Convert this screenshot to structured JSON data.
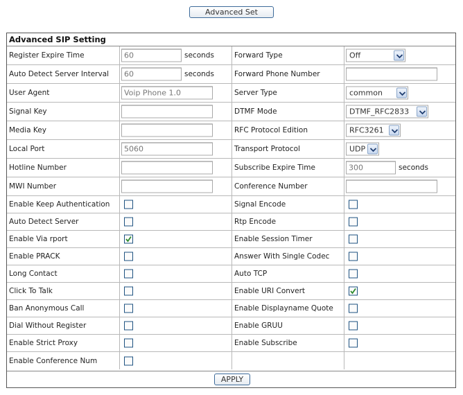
{
  "top": {
    "advanced_set_label": "Advanced Set"
  },
  "panel": {
    "title": "Advanced SIP Setting",
    "apply_label": "APPLY"
  },
  "units": {
    "seconds": "seconds"
  },
  "icons": {
    "dropdown": "chevron-down-icon",
    "checkbox_checked": "checkmark-icon"
  },
  "colors": {
    "checkmark": "#2e8b2e",
    "input_text": "#777777",
    "border": "#555555",
    "button_border": "#3c6a9a"
  },
  "text_rows": [
    {
      "left_label": "Register Expire Time",
      "left_value": "60",
      "left_unit": "seconds",
      "right_label": "Forward Type",
      "right_select": "Off"
    },
    {
      "left_label": "Auto Detect Server Interval",
      "left_value": "60",
      "left_unit": "seconds",
      "right_label": "Forward Phone Number",
      "right_value": ""
    },
    {
      "left_label": "User Agent",
      "left_value": "Voip Phone 1.0",
      "right_label": "Server Type",
      "right_select": "common"
    },
    {
      "left_label": "Signal Key",
      "left_value": "",
      "right_label": "DTMF Mode",
      "right_select": "DTMF_RFC2833"
    },
    {
      "left_label": "Media Key",
      "left_value": "",
      "right_label": "RFC Protocol Edition",
      "right_select": "RFC3261"
    },
    {
      "left_label": "Local Port",
      "left_value": "5060",
      "right_label": "Transport Protocol",
      "right_select": "UDP"
    },
    {
      "left_label": "Hotline Number",
      "left_value": "",
      "right_label": "Subscribe Expire Time",
      "right_value": "300",
      "right_unit": "seconds"
    },
    {
      "left_label": "MWI Number",
      "left_value": "",
      "right_label": "Conference Number",
      "right_value": ""
    }
  ],
  "check_rows": [
    {
      "left_label": "Enable Keep Authentication",
      "left_checked": false,
      "right_label": "Signal Encode",
      "right_checked": false
    },
    {
      "left_label": "Auto Detect Server",
      "left_checked": false,
      "right_label": "Rtp Encode",
      "right_checked": false
    },
    {
      "left_label": "Enable Via rport",
      "left_checked": true,
      "right_label": "Enable Session Timer",
      "right_checked": false
    },
    {
      "left_label": "Enable PRACK",
      "left_checked": false,
      "right_label": "Answer With Single Codec",
      "right_checked": false
    },
    {
      "left_label": "Long Contact",
      "left_checked": false,
      "right_label": "Auto TCP",
      "right_checked": false
    },
    {
      "left_label": "Click To Talk",
      "left_checked": false,
      "right_label": "Enable URI Convert",
      "right_checked": true
    },
    {
      "left_label": "Ban Anonymous Call",
      "left_checked": false,
      "right_label": "Enable Displayname Quote",
      "right_checked": false
    },
    {
      "left_label": "Dial Without Register",
      "left_checked": false,
      "right_label": "Enable GRUU",
      "right_checked": false
    },
    {
      "left_label": "Enable Strict Proxy",
      "left_checked": false,
      "right_label": "Enable Subscribe",
      "right_checked": false
    },
    {
      "left_label": "Enable Conference Num",
      "left_checked": false
    }
  ]
}
